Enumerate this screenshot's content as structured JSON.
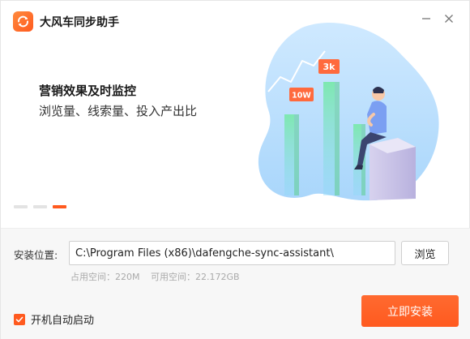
{
  "app": {
    "title": "大风车同步助手",
    "logo_icon": "sync-logo-icon"
  },
  "window_controls": {
    "minimize_icon": "minimize-icon",
    "close_icon": "close-icon"
  },
  "hero": {
    "slogan_title": "营销效果及时监控",
    "slogan_subtitle": "浏览量、线索量、投入产出比",
    "badge_small": "10W",
    "badge_large": "3k"
  },
  "carousel": {
    "dot_count": 3,
    "active_index": 2
  },
  "install": {
    "path_label": "安装位置:",
    "path_value": "C:\\Program Files (x86)\\dafengche-sync-assistant\\",
    "browse_label": "浏览",
    "used_space": "占用空间：220M",
    "available_space": "可用空间：22.172GB",
    "autostart_label": "开机自动启动",
    "autostart_checked": true,
    "install_button_label": "立即安装"
  },
  "colors": {
    "accent": "#ff5a1f",
    "hero_blue": "#cde9ff",
    "hero_green": "#6fe1a6"
  }
}
